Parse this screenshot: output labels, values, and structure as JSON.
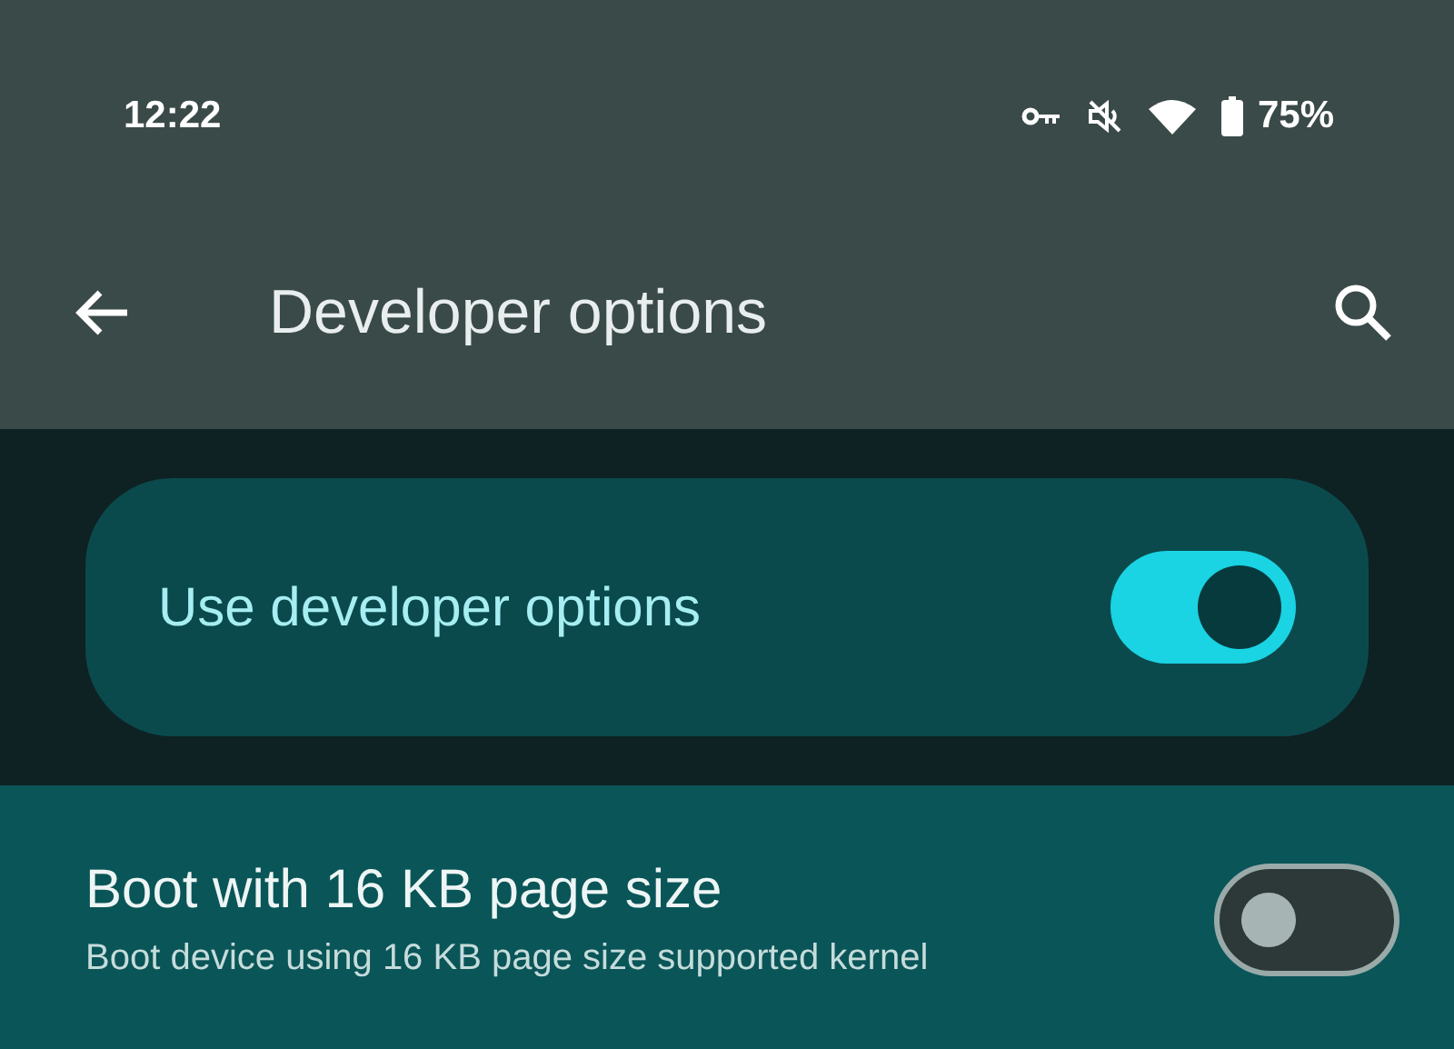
{
  "status_bar": {
    "time": "12:22",
    "battery": "75%"
  },
  "app_bar": {
    "title": "Developer options"
  },
  "main_switch": {
    "label": "Use developer options",
    "on": true
  },
  "settings": [
    {
      "title": "Boot with 16 KB page size",
      "summary": "Boot device using 16 KB page size supported kernel",
      "on": false
    }
  ]
}
